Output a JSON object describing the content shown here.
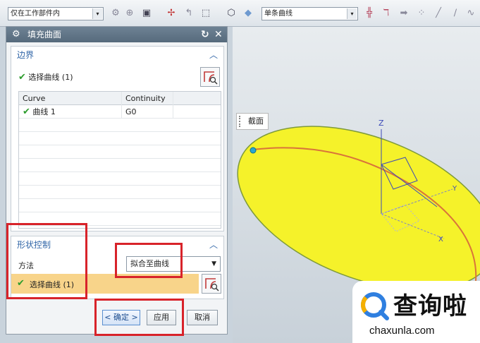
{
  "toolbar": {
    "filter_combo": "仅在工作部件内",
    "curve_rule_combo": "单条曲线",
    "combo_arrow": "▾",
    "icons": [
      "feature-icon",
      "body-icon",
      "face-filter-icon",
      "snap-icon",
      "snap2-icon",
      "rect-select-icon",
      "view-icon",
      "cube-icon",
      "intersection-icon",
      "tangent-icon",
      "arrow-icon",
      "points-icon",
      "line-icon",
      "line2-icon",
      "curve-icon"
    ]
  },
  "dialog": {
    "title": "填充曲面",
    "reset_glyph": "↻",
    "close_glyph": "✕",
    "boundary": {
      "header": "边界",
      "select_label": "选择曲线 (1)",
      "table": {
        "columns": [
          "Curve",
          "Continuity"
        ],
        "rows": [
          {
            "curve": "曲线 1",
            "continuity": "G0"
          }
        ]
      }
    },
    "shape": {
      "header": "形状控制",
      "method_label": "方法",
      "method_value": "拟合至曲线",
      "select_label": "选择曲线 (1)"
    },
    "buttons": {
      "ok": "< 确定 >",
      "apply": "应用",
      "cancel": "取消"
    }
  },
  "viewport": {
    "leader_label": "截面",
    "axis_z": "Z",
    "axis_y": "Y",
    "axis_x": "X",
    "surface_color": "#f5f22a",
    "curve_color": "#d9743a"
  },
  "watermark": {
    "main": "查询啦",
    "sub": "chaxunla.com"
  },
  "colors": {
    "accent": "#3267a8",
    "title_bar": "#5e7386",
    "highlight": "#f8d48a",
    "annotation_red": "#d8232a",
    "check_green": "#2d9c2d"
  }
}
